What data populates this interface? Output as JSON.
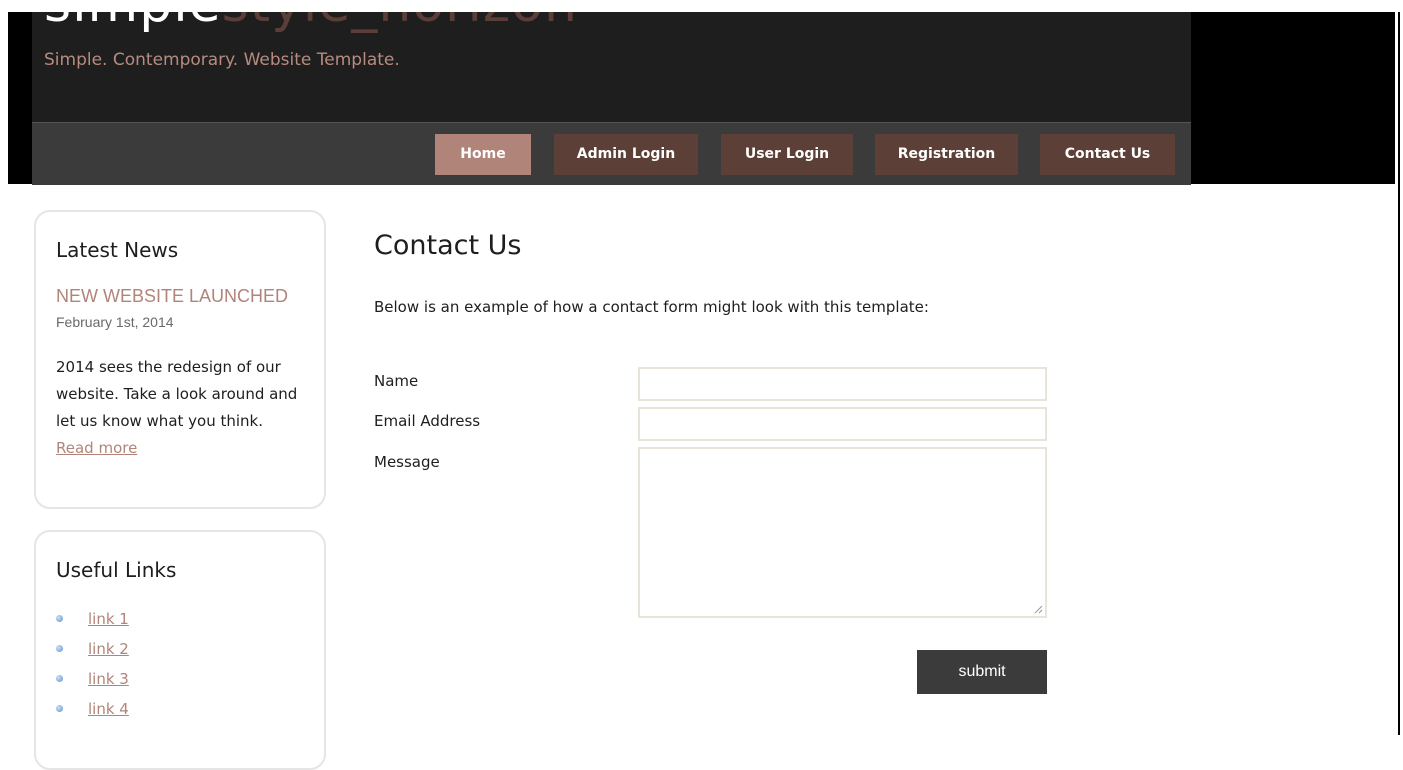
{
  "header": {
    "logo_part1": "simple",
    "logo_part2": "style_horizon",
    "slogan": "Simple. Contemporary. Website Template."
  },
  "menu": {
    "items": [
      {
        "label": "Home",
        "active": true
      },
      {
        "label": "Admin Login",
        "active": false
      },
      {
        "label": "User Login",
        "active": false
      },
      {
        "label": "Registration",
        "active": false
      },
      {
        "label": "Contact Us",
        "active": false
      }
    ]
  },
  "sidebar": {
    "news": {
      "heading": "Latest News",
      "title": "NEW WEBSITE LAUNCHED",
      "date": "February 1st, 2014",
      "body": "2014 sees the redesign of our website. Take a look around and let us know what you think.",
      "read_more": "Read more"
    },
    "links": {
      "heading": "Useful Links",
      "items": [
        "link 1",
        "link 2",
        "link 3",
        "link 4"
      ]
    }
  },
  "content": {
    "heading": "Contact Us",
    "intro": "Below is an example of how a contact form might look with this template:",
    "form": {
      "name_label": "Name",
      "email_label": "Email Address",
      "message_label": "Message",
      "name_value": "",
      "email_value": "",
      "message_value": "",
      "submit_label": "submit"
    }
  },
  "colors": {
    "accent": "#b1847a",
    "menu_bg": "#5c3f37",
    "header_bg": "#1e1e1e",
    "menubar_bg": "#3b3b3b"
  }
}
